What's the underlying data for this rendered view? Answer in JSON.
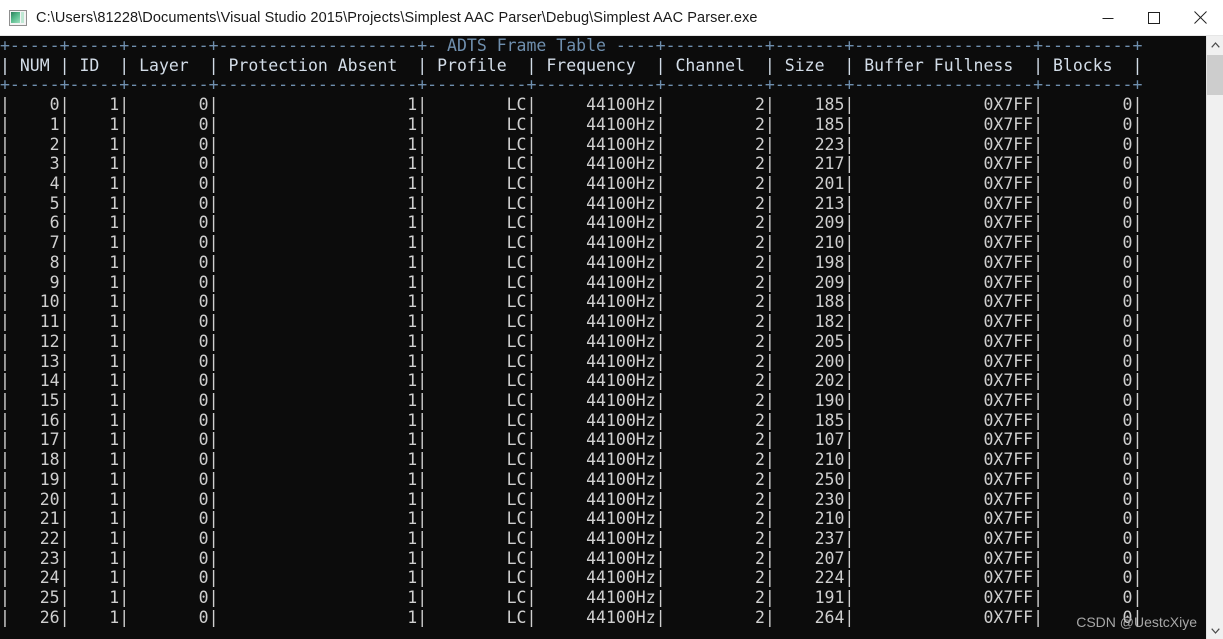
{
  "window": {
    "title": "C:\\Users\\81228\\Documents\\Visual Studio 2015\\Projects\\Simplest AAC Parser\\Debug\\Simplest AAC Parser.exe",
    "icon": "console-app-icon",
    "minimize_label": "—",
    "maximize_label": "□",
    "close_label": "×"
  },
  "console": {
    "table_title": "ADTS Frame Table",
    "background_color": "#0c0c0c",
    "foreground_color": "#cccccc",
    "separator_color": "#3b78a8",
    "columns": [
      {
        "key": "num",
        "header": "NUM",
        "width": 5
      },
      {
        "key": "id",
        "header": "ID",
        "width": 5
      },
      {
        "key": "layer",
        "header": "Layer",
        "width": 8
      },
      {
        "key": "prot",
        "header": "Protection Absent",
        "width": 20
      },
      {
        "key": "prof",
        "header": "Profile",
        "width": 10
      },
      {
        "key": "freq",
        "header": "Frequency",
        "width": 12
      },
      {
        "key": "chan",
        "header": "Channel",
        "width": 10
      },
      {
        "key": "size",
        "header": "Size",
        "width": 7
      },
      {
        "key": "buffer",
        "header": "Buffer Fullness",
        "width": 18
      },
      {
        "key": "blocks",
        "header": "Blocks",
        "width": 9
      }
    ],
    "rows": [
      {
        "num": "0",
        "id": "1",
        "layer": "0",
        "prot": "1",
        "prof": "LC",
        "freq": "44100Hz",
        "chan": "2",
        "size": "185",
        "buffer": "0X7FF",
        "blocks": "0"
      },
      {
        "num": "1",
        "id": "1",
        "layer": "0",
        "prot": "1",
        "prof": "LC",
        "freq": "44100Hz",
        "chan": "2",
        "size": "185",
        "buffer": "0X7FF",
        "blocks": "0"
      },
      {
        "num": "2",
        "id": "1",
        "layer": "0",
        "prot": "1",
        "prof": "LC",
        "freq": "44100Hz",
        "chan": "2",
        "size": "223",
        "buffer": "0X7FF",
        "blocks": "0"
      },
      {
        "num": "3",
        "id": "1",
        "layer": "0",
        "prot": "1",
        "prof": "LC",
        "freq": "44100Hz",
        "chan": "2",
        "size": "217",
        "buffer": "0X7FF",
        "blocks": "0"
      },
      {
        "num": "4",
        "id": "1",
        "layer": "0",
        "prot": "1",
        "prof": "LC",
        "freq": "44100Hz",
        "chan": "2",
        "size": "201",
        "buffer": "0X7FF",
        "blocks": "0"
      },
      {
        "num": "5",
        "id": "1",
        "layer": "0",
        "prot": "1",
        "prof": "LC",
        "freq": "44100Hz",
        "chan": "2",
        "size": "213",
        "buffer": "0X7FF",
        "blocks": "0"
      },
      {
        "num": "6",
        "id": "1",
        "layer": "0",
        "prot": "1",
        "prof": "LC",
        "freq": "44100Hz",
        "chan": "2",
        "size": "209",
        "buffer": "0X7FF",
        "blocks": "0"
      },
      {
        "num": "7",
        "id": "1",
        "layer": "0",
        "prot": "1",
        "prof": "LC",
        "freq": "44100Hz",
        "chan": "2",
        "size": "210",
        "buffer": "0X7FF",
        "blocks": "0"
      },
      {
        "num": "8",
        "id": "1",
        "layer": "0",
        "prot": "1",
        "prof": "LC",
        "freq": "44100Hz",
        "chan": "2",
        "size": "198",
        "buffer": "0X7FF",
        "blocks": "0"
      },
      {
        "num": "9",
        "id": "1",
        "layer": "0",
        "prot": "1",
        "prof": "LC",
        "freq": "44100Hz",
        "chan": "2",
        "size": "209",
        "buffer": "0X7FF",
        "blocks": "0"
      },
      {
        "num": "10",
        "id": "1",
        "layer": "0",
        "prot": "1",
        "prof": "LC",
        "freq": "44100Hz",
        "chan": "2",
        "size": "188",
        "buffer": "0X7FF",
        "blocks": "0"
      },
      {
        "num": "11",
        "id": "1",
        "layer": "0",
        "prot": "1",
        "prof": "LC",
        "freq": "44100Hz",
        "chan": "2",
        "size": "182",
        "buffer": "0X7FF",
        "blocks": "0"
      },
      {
        "num": "12",
        "id": "1",
        "layer": "0",
        "prot": "1",
        "prof": "LC",
        "freq": "44100Hz",
        "chan": "2",
        "size": "205",
        "buffer": "0X7FF",
        "blocks": "0"
      },
      {
        "num": "13",
        "id": "1",
        "layer": "0",
        "prot": "1",
        "prof": "LC",
        "freq": "44100Hz",
        "chan": "2",
        "size": "200",
        "buffer": "0X7FF",
        "blocks": "0"
      },
      {
        "num": "14",
        "id": "1",
        "layer": "0",
        "prot": "1",
        "prof": "LC",
        "freq": "44100Hz",
        "chan": "2",
        "size": "202",
        "buffer": "0X7FF",
        "blocks": "0"
      },
      {
        "num": "15",
        "id": "1",
        "layer": "0",
        "prot": "1",
        "prof": "LC",
        "freq": "44100Hz",
        "chan": "2",
        "size": "190",
        "buffer": "0X7FF",
        "blocks": "0"
      },
      {
        "num": "16",
        "id": "1",
        "layer": "0",
        "prot": "1",
        "prof": "LC",
        "freq": "44100Hz",
        "chan": "2",
        "size": "185",
        "buffer": "0X7FF",
        "blocks": "0"
      },
      {
        "num": "17",
        "id": "1",
        "layer": "0",
        "prot": "1",
        "prof": "LC",
        "freq": "44100Hz",
        "chan": "2",
        "size": "107",
        "buffer": "0X7FF",
        "blocks": "0"
      },
      {
        "num": "18",
        "id": "1",
        "layer": "0",
        "prot": "1",
        "prof": "LC",
        "freq": "44100Hz",
        "chan": "2",
        "size": "210",
        "buffer": "0X7FF",
        "blocks": "0"
      },
      {
        "num": "19",
        "id": "1",
        "layer": "0",
        "prot": "1",
        "prof": "LC",
        "freq": "44100Hz",
        "chan": "2",
        "size": "250",
        "buffer": "0X7FF",
        "blocks": "0"
      },
      {
        "num": "20",
        "id": "1",
        "layer": "0",
        "prot": "1",
        "prof": "LC",
        "freq": "44100Hz",
        "chan": "2",
        "size": "230",
        "buffer": "0X7FF",
        "blocks": "0"
      },
      {
        "num": "21",
        "id": "1",
        "layer": "0",
        "prot": "1",
        "prof": "LC",
        "freq": "44100Hz",
        "chan": "2",
        "size": "210",
        "buffer": "0X7FF",
        "blocks": "0"
      },
      {
        "num": "22",
        "id": "1",
        "layer": "0",
        "prot": "1",
        "prof": "LC",
        "freq": "44100Hz",
        "chan": "2",
        "size": "237",
        "buffer": "0X7FF",
        "blocks": "0"
      },
      {
        "num": "23",
        "id": "1",
        "layer": "0",
        "prot": "1",
        "prof": "LC",
        "freq": "44100Hz",
        "chan": "2",
        "size": "207",
        "buffer": "0X7FF",
        "blocks": "0"
      },
      {
        "num": "24",
        "id": "1",
        "layer": "0",
        "prot": "1",
        "prof": "LC",
        "freq": "44100Hz",
        "chan": "2",
        "size": "224",
        "buffer": "0X7FF",
        "blocks": "0"
      },
      {
        "num": "25",
        "id": "1",
        "layer": "0",
        "prot": "1",
        "prof": "LC",
        "freq": "44100Hz",
        "chan": "2",
        "size": "191",
        "buffer": "0X7FF",
        "blocks": "0"
      },
      {
        "num": "26",
        "id": "1",
        "layer": "0",
        "prot": "1",
        "prof": "LC",
        "freq": "44100Hz",
        "chan": "2",
        "size": "264",
        "buffer": "0X7FF",
        "blocks": "0"
      }
    ]
  },
  "scrollbar": {
    "up_arrow": "chevron-up",
    "down_arrow": "chevron-down",
    "thumb_position_percent": 3
  },
  "watermark": {
    "text": "CSDN @UestcXiye"
  }
}
